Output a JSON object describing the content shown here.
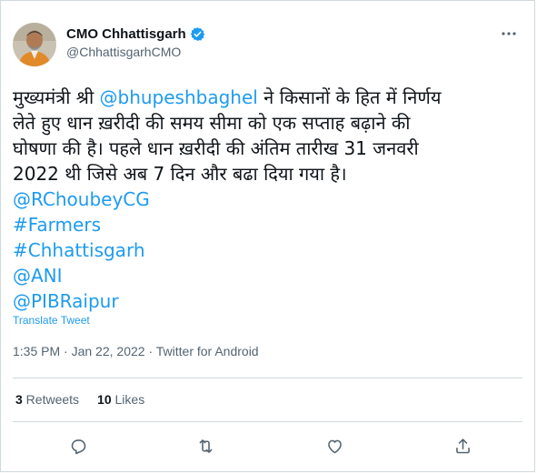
{
  "author": {
    "name": "CMO Chhattisgarh",
    "handle": "@ChhattisgarhCMO",
    "verified": true
  },
  "tweet": {
    "line1_prefix": "मुख्यमंत्री श्री ",
    "mention_main": "@bhupeshbaghel",
    "line1_suffix": " ने किसानों के हित में निर्णय",
    "line2": "लेते हुए धान ख़रीदी की समय सीमा को एक सप्ताह बढ़ाने की",
    "line3": "घोषणा की है। पहले धान ख़रीदी की अंतिम तारीख 31 जनवरी",
    "line4": "2022 थी जिसे अब 7 दिन और बढा दिया गया है।",
    "tags": [
      "@RChoubeyCG",
      "#Farmers",
      "#Chhattisgarh",
      "@ANI",
      "@PIBRaipur"
    ]
  },
  "translate_label": "Translate Tweet",
  "meta": {
    "time": "1:35 PM",
    "separator1": " · ",
    "date": "Jan 22, 2022",
    "separator2": " · ",
    "source": "Twitter for Android"
  },
  "stats": {
    "retweets_count": "3",
    "retweets_label": " Retweets",
    "likes_count": "10",
    "likes_label": " Likes"
  },
  "actions": [
    "reply-icon",
    "retweet-icon",
    "like-icon",
    "share-icon"
  ],
  "colors": {
    "link": "#1d9bf0",
    "secondary_text": "#536471",
    "border": "#cfd9de",
    "verified": "#1d9bf0"
  }
}
